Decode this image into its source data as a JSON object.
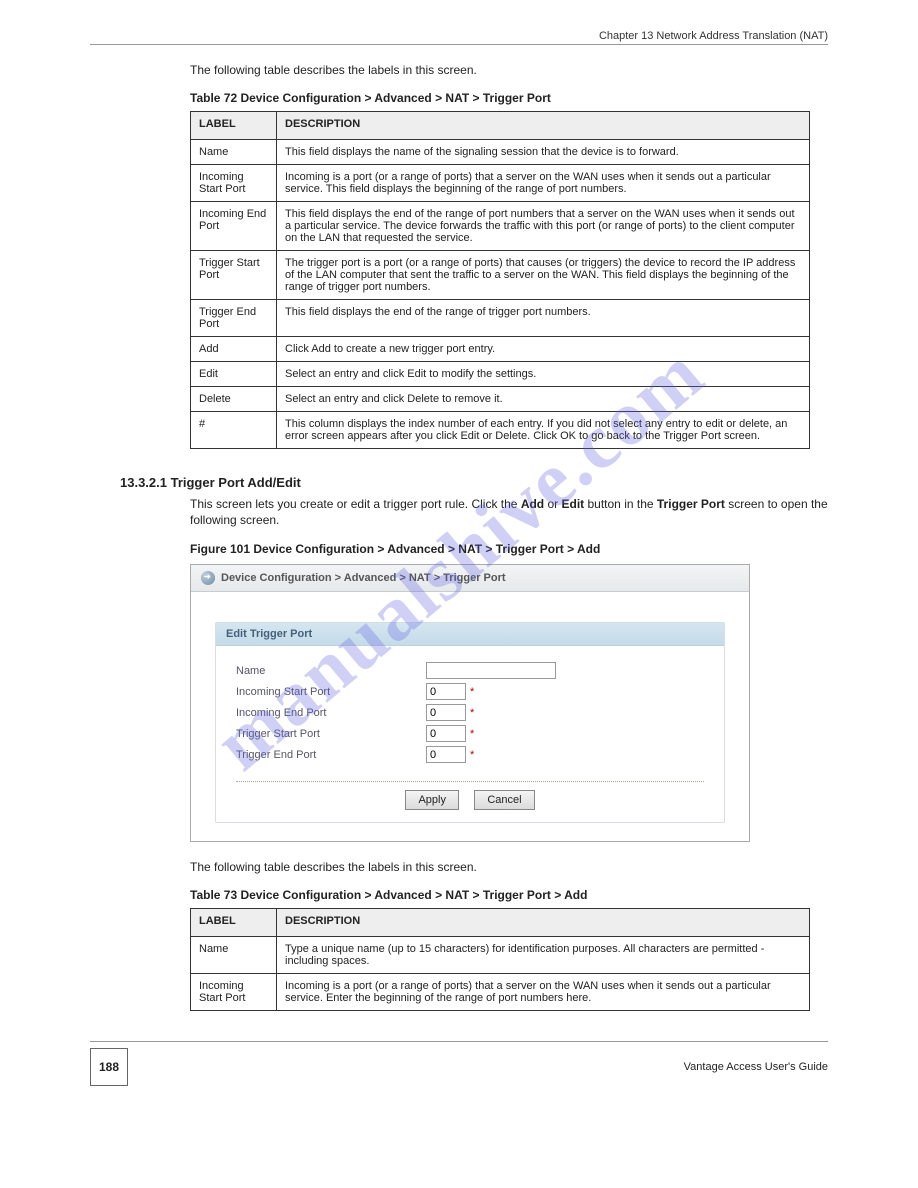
{
  "header": "Chapter 13 Network Address Translation (NAT)",
  "intro": "The following table describes the labels in this screen.",
  "table1": {
    "caption": "Table 72   Device Configuration > Advanced > NAT > Trigger Port",
    "columns": [
      "LABEL",
      "DESCRIPTION"
    ],
    "rows": [
      {
        "label": "Name",
        "desc": "This field displays the name of the signaling session that the device is to forward."
      },
      {
        "label": "Incoming Start Port",
        "desc": "Incoming is a port (or a range of ports) that a server on the WAN uses when it sends out a particular service. This field displays the beginning of the range of port numbers."
      },
      {
        "label": "Incoming End Port",
        "desc": "This field displays the end of the range of port numbers that a server on the WAN uses when it sends out a particular service. The device forwards the traffic with this port (or range of ports) to the client computer on the LAN that requested the service."
      },
      {
        "label": "Trigger Start Port",
        "desc": "The trigger port is a port (or a range of ports) that causes (or triggers) the device to record the IP address of the LAN computer that sent the traffic to a server on the WAN. This field displays the beginning of the range of trigger port numbers."
      },
      {
        "label": "Trigger End Port",
        "desc": "This field displays the end of the range of trigger port numbers."
      },
      {
        "label": "Add",
        "desc": "Click Add to create a new trigger port entry."
      },
      {
        "label": "Edit",
        "desc": "Select an entry and click Edit to modify the settings."
      },
      {
        "label": "Delete",
        "desc": "Select an entry and click Delete to remove it."
      },
      {
        "label": "#",
        "desc": "This column displays the index number of each entry. If you did not select any entry to edit or delete, an error screen appears after you click Edit or Delete. Click OK to go back to the Trigger Port screen."
      }
    ]
  },
  "section": {
    "num": "13.3.2.1  Trigger Port Add/Edit",
    "body_a": "This screen lets you create or edit a trigger port rule. Click the ",
    "body_add": "Add",
    "body_or": " or ",
    "body_edit": "Edit",
    "body_b": " button in the ",
    "body_trigger": "Trigger Port",
    "body_c": " screen to open the following screen."
  },
  "figure_caption": "Figure 101   Device Configuration > Advanced > NAT > Trigger Port > Add",
  "screenshot": {
    "breadcrumb": "Device Configuration > Advanced > NAT > Trigger Port",
    "panel_title": "Edit Trigger Port",
    "fields": {
      "name_label": "Name",
      "name_value": "",
      "in_start_label": "Incoming Start Port",
      "in_start_value": "0",
      "in_end_label": "Incoming End Port",
      "in_end_value": "0",
      "trg_start_label": "Trigger Start Port",
      "trg_start_value": "0",
      "trg_end_label": "Trigger End Port",
      "trg_end_value": "0"
    },
    "buttons": {
      "apply": "Apply",
      "cancel": "Cancel"
    }
  },
  "intro2": "The following table describes the labels in this screen.",
  "table2": {
    "caption": "Table 73   Device Configuration > Advanced > NAT > Trigger Port > Add",
    "columns": [
      "LABEL",
      "DESCRIPTION"
    ],
    "rows": [
      {
        "label": "Name",
        "desc": "Type a unique name (up to 15 characters) for identification purposes. All characters are permitted - including spaces."
      },
      {
        "label": "Incoming Start Port",
        "desc": "Incoming is a port (or a range of ports) that a server on the WAN uses when it sends out a particular service. Enter the beginning of the range of port numbers here."
      }
    ]
  },
  "footer": {
    "page": "188",
    "guide": "Vantage Access User's Guide"
  },
  "watermark": "manualshive.com"
}
